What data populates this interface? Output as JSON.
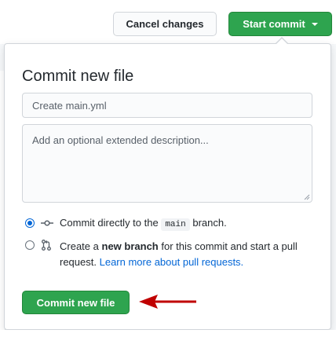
{
  "header": {
    "cancel_label": "Cancel changes",
    "start_label": "Start commit"
  },
  "panel": {
    "title": "Commit new file",
    "summary_placeholder": "Create main.yml",
    "description_placeholder": "Add an optional extended description..."
  },
  "options": {
    "direct": {
      "prefix": "Commit directly to the",
      "branch": "main",
      "suffix": "branch.",
      "selected": true,
      "icon": "git-commit-icon"
    },
    "new_branch": {
      "prefix": "Create a",
      "bold": "new branch",
      "middle": "for this commit and start a pull request.",
      "link": "Learn more about pull requests.",
      "selected": false,
      "icon": "git-pull-request-icon"
    }
  },
  "footer": {
    "commit_label": "Commit new file"
  },
  "colors": {
    "green": "#2ea44f",
    "blue": "#0366d6",
    "annotation_arrow": "#c00000"
  }
}
